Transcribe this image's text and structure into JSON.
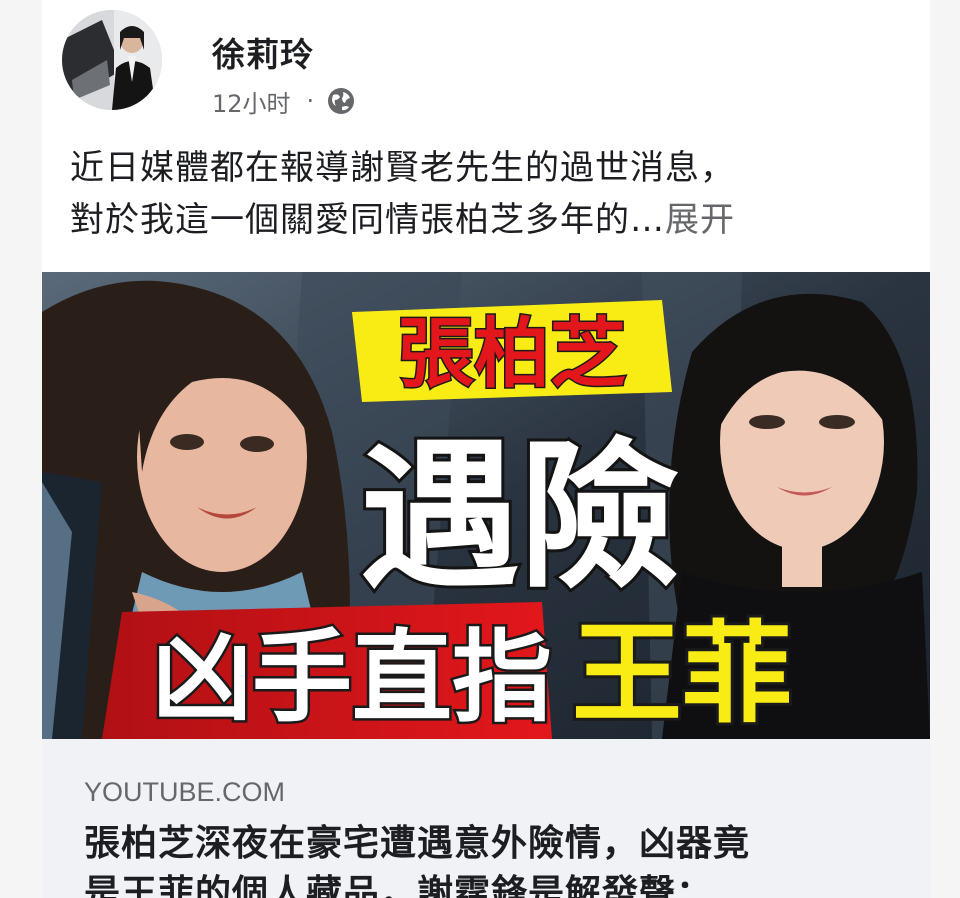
{
  "post": {
    "author": "徐莉玲",
    "time": "12小时",
    "separator": "·",
    "audience_icon": "globe-icon",
    "text_line1": "近日媒體都在報導謝賢老先生的過世消息，",
    "text_line2": "對於我這一個關愛同情張柏芝多年的…",
    "see_more": "展开"
  },
  "thumbnail": {
    "line1": "張柏芝",
    "line2": "遇險",
    "line3_a": "凶手直指",
    "line3_b": "王菲"
  },
  "link": {
    "domain": "YOUTUBE.COM",
    "title_line1": "張柏芝深夜在豪宅遭遇意外險情，凶器竟",
    "title_line2": "是王菲的個人藏品，謝霆鋒是解發聲："
  },
  "colors": {
    "headline_yellow": "#f8ec14",
    "headline_red": "#e3171b",
    "meta_gray": "#65676b",
    "link_bg": "#f0f2f5"
  }
}
